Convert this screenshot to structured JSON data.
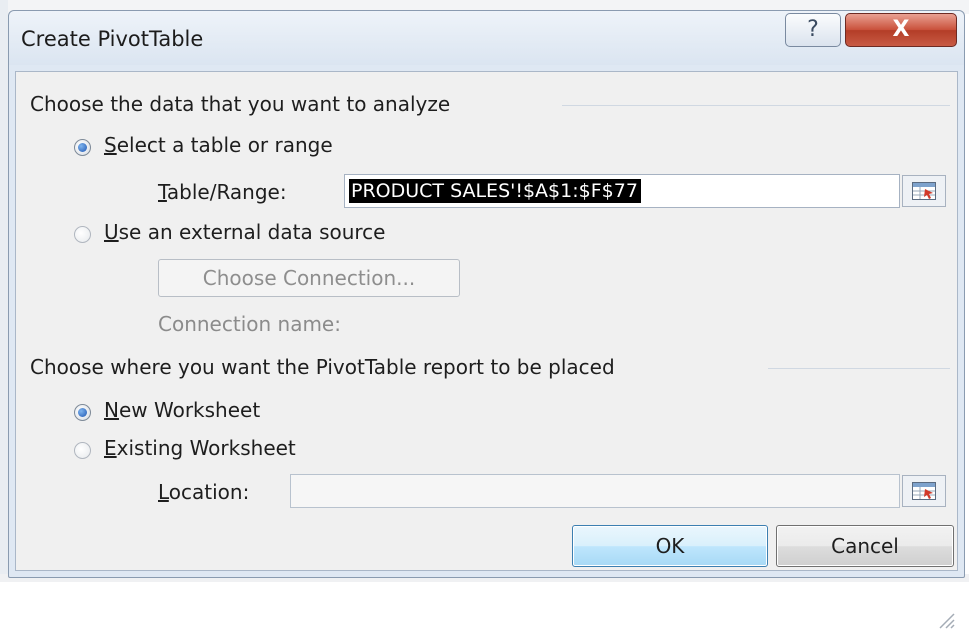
{
  "dialog": {
    "title": "Create PivotTable",
    "help_glyph": "?",
    "close_glyph": "X"
  },
  "data_section": {
    "heading": "Choose the data that you want to analyze",
    "option_table_range": {
      "accel": "S",
      "rest": "elect a table or range",
      "selected": true
    },
    "table_range": {
      "label_accel": "T",
      "label_rest": "able/Range:",
      "value": "PRODUCT SALES'!$A$1:$F$77"
    },
    "option_external": {
      "accel": "U",
      "rest": "se an external data source",
      "selected": false
    },
    "choose_connection_label": "Choose Connection...",
    "connection_name_label": "Connection name:"
  },
  "placement_section": {
    "heading": "Choose where you want the PivotTable report to be placed",
    "option_new_worksheet": {
      "accel": "N",
      "rest": "ew Worksheet",
      "selected": true
    },
    "option_existing_worksheet": {
      "accel": "E",
      "rest": "xisting Worksheet",
      "selected": false
    },
    "location": {
      "label_accel": "L",
      "label_rest": "ocation:",
      "value": ""
    }
  },
  "buttons": {
    "ok_label": "OK",
    "cancel_label": "Cancel"
  },
  "colors": {
    "selection_bg": "#000000",
    "close_button": "#c9503a",
    "ok_button_border": "#3c7fb1"
  }
}
